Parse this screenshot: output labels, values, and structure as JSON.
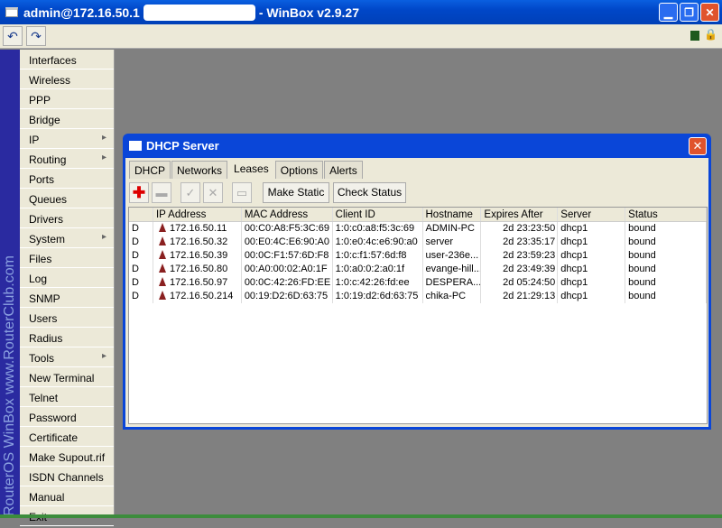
{
  "window": {
    "title_prefix": "admin@172.16.50.1",
    "title_suffix": "- WinBox v2.9.27"
  },
  "toolbar": {
    "undo_icon": "undo-icon",
    "redo_icon": "redo-icon"
  },
  "sidebar": {
    "brand": "RouterOS WinBox   www.RouterClub.com",
    "items": [
      {
        "label": "Interfaces"
      },
      {
        "label": "Wireless"
      },
      {
        "label": "PPP"
      },
      {
        "label": "Bridge"
      },
      {
        "label": "IP",
        "submenu": true
      },
      {
        "label": "Routing",
        "submenu": true
      },
      {
        "label": "Ports"
      },
      {
        "label": "Queues"
      },
      {
        "label": "Drivers"
      },
      {
        "label": "System",
        "submenu": true
      },
      {
        "label": "Files"
      },
      {
        "label": "Log"
      },
      {
        "label": "SNMP"
      },
      {
        "label": "Users"
      },
      {
        "label": "Radius"
      },
      {
        "label": "Tools",
        "submenu": true
      },
      {
        "label": "New Terminal"
      },
      {
        "label": "Telnet"
      },
      {
        "label": "Password"
      },
      {
        "label": "Certificate"
      },
      {
        "label": "Make Supout.rif"
      },
      {
        "label": "ISDN Channels"
      },
      {
        "label": "Manual"
      },
      {
        "label": "Exit"
      }
    ]
  },
  "dialog": {
    "title": "DHCP Server",
    "tabs": [
      "DHCP",
      "Networks",
      "Leases",
      "Options",
      "Alerts"
    ],
    "active_tab": "Leases",
    "buttons": {
      "make_static": "Make Static",
      "check_status": "Check Status"
    },
    "columns": [
      "",
      "IP Address",
      "MAC Address",
      "Client ID",
      "Hostname",
      "Expires After",
      "Server",
      "Status"
    ],
    "rows": [
      [
        "D",
        "172.16.50.11",
        "00:C0:A8:F5:3C:69",
        "1:0:c0:a8:f5:3c:69",
        "ADMIN-PC",
        "2d 23:23:50",
        "dhcp1",
        "bound"
      ],
      [
        "D",
        "172.16.50.32",
        "00:E0:4C:E6:90:A0",
        "1:0:e0:4c:e6:90:a0",
        "server",
        "2d 23:35:17",
        "dhcp1",
        "bound"
      ],
      [
        "D",
        "172.16.50.39",
        "00:0C:F1:57:6D:F8",
        "1:0:c:f1:57:6d:f8",
        "user-236e...",
        "2d 23:59:23",
        "dhcp1",
        "bound"
      ],
      [
        "D",
        "172.16.50.80",
        "00:A0:00:02:A0:1F",
        "1:0:a0:0:2:a0:1f",
        "evange-hill...",
        "2d 23:49:39",
        "dhcp1",
        "bound"
      ],
      [
        "D",
        "172.16.50.97",
        "00:0C:42:26:FD:EE",
        "1:0:c:42:26:fd:ee",
        "DESPERA...",
        "2d 05:24:50",
        "dhcp1",
        "bound"
      ],
      [
        "D",
        "172.16.50.214",
        "00:19:D2:6D:63:75",
        "1:0:19:d2:6d:63:75",
        "chika-PC",
        "2d 21:29:13",
        "dhcp1",
        "bound"
      ]
    ]
  }
}
